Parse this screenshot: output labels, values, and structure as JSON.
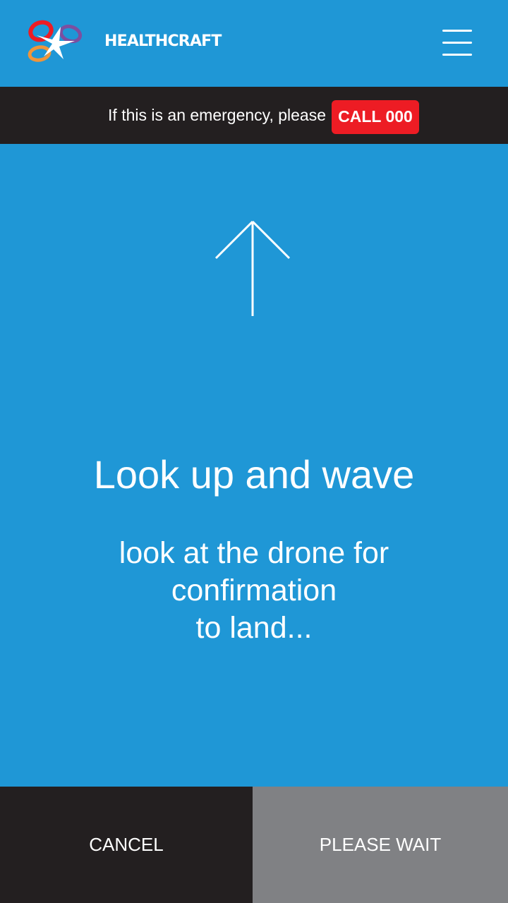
{
  "header": {
    "brand": "HEALTHCRAFT",
    "logo_icon": "healthcraft-logo-icon",
    "menu_icon": "hamburger-menu-icon"
  },
  "emergency_banner": {
    "text": "If this is an emergency, please",
    "call_label": "CALL 000"
  },
  "main": {
    "direction_icon": "arrow-up-icon",
    "headline": "Look up and wave",
    "instruction_lines": [
      "look at the drone for",
      "confirmation",
      "to land..."
    ]
  },
  "footer": {
    "cancel_label": "CANCEL",
    "wait_label": "PLEASE WAIT"
  },
  "colors": {
    "primary_blue": "#1f97d6",
    "dark": "#231f20",
    "emergency_red": "#ed1c24",
    "disabled_gray": "#808184"
  }
}
